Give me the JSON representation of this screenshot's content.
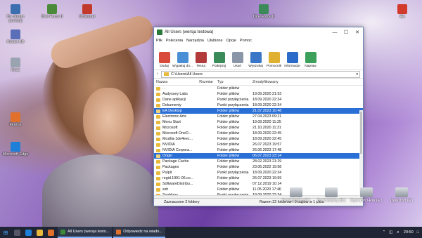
{
  "desktop_icons": [
    {
      "label": "Do Steam pomocji",
      "color": "#3b6fb0"
    },
    {
      "label": "Dire Force II",
      "color": "#4b8a3a"
    },
    {
      "label": "CCleaner",
      "color": "#c23a2c"
    },
    {
      "label": "Dire Force II",
      "color": "#3c8a5a"
    },
    {
      "label": "EA",
      "color": "#d23a2c"
    },
    {
      "label": "Chess HD",
      "color": "#5a6fb8"
    },
    {
      "label": "Kosz",
      "color": "#9aa3b0"
    },
    {
      "label": "Firefox",
      "color": "#e0702a"
    },
    {
      "label": "Microsoft Edge",
      "color": "#1d7fd8"
    }
  ],
  "window": {
    "title": "All Users (wersja testowa)",
    "menu": [
      "Plik",
      "Polecenia",
      "Narzędzia",
      "Ulubione",
      "Opcje",
      "Pomoc"
    ],
    "toolbar": [
      {
        "label": "Dodaj",
        "icon": "add-archive-icon",
        "color": "#d94a3a"
      },
      {
        "label": "Wypakuj do...",
        "icon": "extract-folder-icon",
        "color": "#4a8fd6"
      },
      {
        "label": "Testuj",
        "icon": "test-icon",
        "color": "#b23a3a"
      },
      {
        "label": "Podejrzyj",
        "icon": "view-icon",
        "color": "#3a8a5a"
      },
      {
        "label": "Usuń",
        "icon": "trash-icon",
        "color": "#8a96a8"
      },
      {
        "label": "Wyszukaj",
        "icon": "search-icon",
        "color": "#3a76c8"
      },
      {
        "label": "Pomocnik",
        "icon": "wizard-icon",
        "color": "#e0b030"
      },
      {
        "label": "Informacje",
        "icon": "info-icon",
        "color": "#2a6ac8"
      },
      {
        "label": "Napraw",
        "icon": "repair-icon",
        "color": "#3aa05a"
      }
    ],
    "address": "C:\\Users\\All Users",
    "columns": {
      "name": "Nazwa",
      "size": "Rozmiar",
      "type": "Typ",
      "modified": "Zmodyfikowany"
    },
    "files": [
      {
        "name": "..",
        "type": "Folder plików",
        "modified": ""
      },
      {
        "name": "Audyssey Labs",
        "type": "Folder plików",
        "modified": "19.09.2020 21:53"
      },
      {
        "name": "Dane aplikacji",
        "type": "Punkt przyłączenia",
        "modified": "18.09.2020 22:34"
      },
      {
        "name": "Dokumenty",
        "type": "Punkt przyłączenia",
        "modified": "18.09.2020 22:34"
      },
      {
        "name": "EA Desktop",
        "type": "Folder plików",
        "modified": "21.07.2023 10:48",
        "selected": true
      },
      {
        "name": "Electronic Arts",
        "type": "Folder plików",
        "modified": "27.04.2023 09:21"
      },
      {
        "name": "Menu Start",
        "type": "Folder plików",
        "modified": "19.09.2020 11:25"
      },
      {
        "name": "Microsoft",
        "type": "Folder plików",
        "modified": "21.10.2020 11:31"
      },
      {
        "name": "Microsoft OneD...",
        "type": "Folder plików",
        "modified": "18.09.2020 22:45"
      },
      {
        "name": "Mozilla-1de4eec...",
        "type": "Folder plików",
        "modified": "18.09.2020 22:45"
      },
      {
        "name": "NVIDIA",
        "type": "Folder plików",
        "modified": "26.07.2023 19:57"
      },
      {
        "name": "NVIDIA Corpora...",
        "type": "Folder plików",
        "modified": "26.06.2023 17:48"
      },
      {
        "name": "Origin",
        "type": "Folder plików",
        "modified": "06.07.2023 23:14",
        "selected": true
      },
      {
        "name": "Package Cache",
        "type": "Folder plików",
        "modified": "28.02.2023 21:29"
      },
      {
        "name": "Packages",
        "type": "Folder plików",
        "modified": "23.06.2022 19:58"
      },
      {
        "name": "Pulpit",
        "type": "Punkt przyłączenia",
        "modified": "18.09.2020 22:34"
      },
      {
        "name": "regid.1991-06.co...",
        "type": "Folder plików",
        "modified": "26.07.2023 19:59"
      },
      {
        "name": "SoftwareDistribu...",
        "type": "Folder plików",
        "modified": "07.12.2019 10:14"
      },
      {
        "name": "ssh",
        "type": "Folder plików",
        "modified": "11.05.2020 17:46"
      },
      {
        "name": "Szablony",
        "type": "Punkt przyłączenia",
        "modified": "18.09.2020 22:34"
      }
    ],
    "status_left": "Zaznaczone 2 foldery",
    "status_right": "Razem 22 folderów i 0 bajtów w 1 pliku"
  },
  "drives": [
    "Dysk lokalny (C:)",
    "Dysk lokalny (D:)",
    "Dysk DVD-RW (E:)",
    "DyskUSB (F:)"
  ],
  "taskbar": {
    "tasks": [
      {
        "label": "All Users (wersja testo...",
        "color": "#3a8a3a"
      },
      {
        "label": "Odpowiedz na wiado...",
        "color": "#e0702a"
      }
    ],
    "clock": "20:50"
  }
}
